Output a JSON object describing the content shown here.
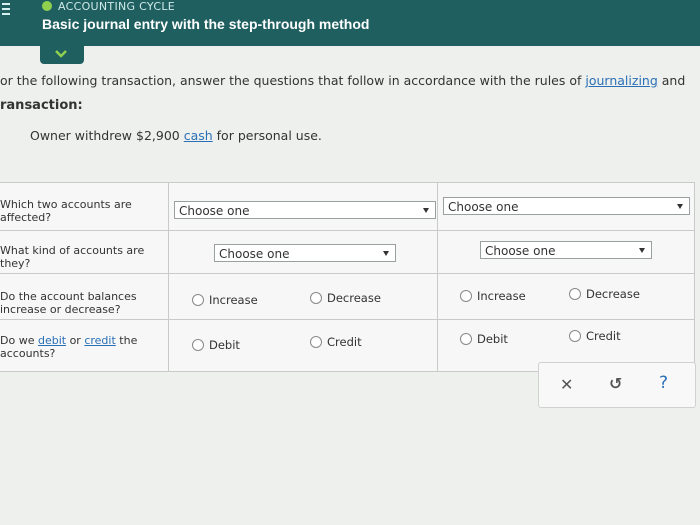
{
  "header": {
    "breadcrumb": "ACCOUNTING CYCLE",
    "title": "Basic journal entry with the step-through method"
  },
  "instructions": {
    "prefix": "or the following transaction, answer the questions that follow in accordance with the rules of ",
    "link": "journalizing",
    "suffix": " and"
  },
  "transaction": {
    "heading": "ransaction:",
    "text_prefix": "Owner withdrew $2,900 ",
    "text_link": "cash",
    "text_suffix": " for personal use."
  },
  "questions": {
    "q1": {
      "line1": "Which two accounts are",
      "line2": "affected?"
    },
    "q2": {
      "line1": "What kind of accounts are",
      "line2": "they?"
    },
    "q3": {
      "line1": "Do the account balances",
      "line2": "increase or decrease?"
    },
    "q4": {
      "line1a": "Do we ",
      "link1": "debit",
      "line1b": " or ",
      "link2": "credit",
      "line1c": " the",
      "line2": "accounts?"
    }
  },
  "dropdowns": {
    "placeholder": "Choose one"
  },
  "options": {
    "increase": "Increase",
    "decrease": "Decrease",
    "debit": "Debit",
    "credit": "Credit"
  },
  "toolbar": {
    "close": "✕",
    "reset": "↺",
    "help": "?"
  },
  "colors": {
    "header_bg": "#1f5f60",
    "accent_green": "#8fd14f",
    "link": "#2a6fb5"
  }
}
